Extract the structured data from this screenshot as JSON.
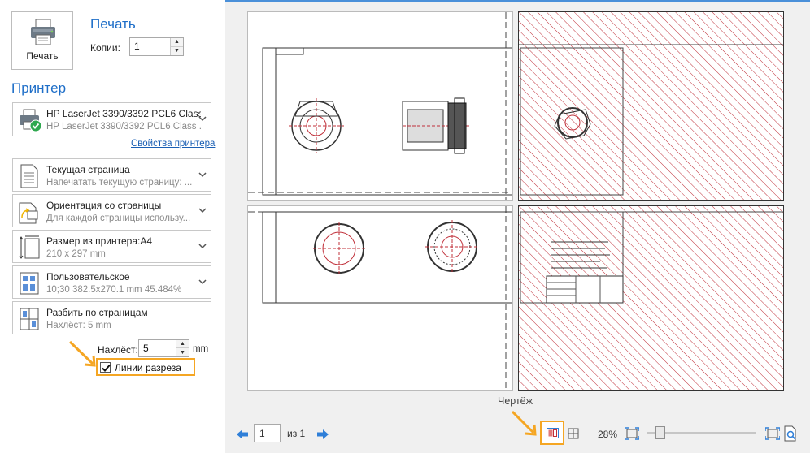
{
  "print": {
    "button_label": "Печать",
    "heading": "Печать",
    "copies_label": "Копии:",
    "copies_value": "1"
  },
  "printer": {
    "heading": "Принтер",
    "name": "HP LaserJet 3390/3392 PCL6 Class ...",
    "subtitle": "HP LaserJet 3390/3392 PCL6 Class ...",
    "properties_link": "Свойства принтера"
  },
  "settings": [
    {
      "title": "Текущая страница",
      "subtitle": "Напечатать текущую страницу: ...",
      "icon": "page-icon"
    },
    {
      "title": "Ориентация со страницы",
      "subtitle": "Для каждой страницы использу...",
      "icon": "orientation-icon"
    },
    {
      "title": "Размер из принтера:A4",
      "subtitle": "210 x 297 mm",
      "icon": "paper-size-icon"
    },
    {
      "title": "Пользовательское",
      "subtitle": "10;30   382.5x270.1 mm 45.484%",
      "icon": "scale-icon"
    },
    {
      "title": "Разбить по страницам",
      "subtitle": "Нахлёст: 5 mm",
      "icon": "split-pages-icon"
    }
  ],
  "overlap": {
    "label": "Нахлёст:",
    "value": "5",
    "unit": "mm"
  },
  "cut_lines": {
    "label": "Линии разреза",
    "checked": true
  },
  "preview": {
    "drawing_label": "Чертёж",
    "page_number": "1",
    "page_of": "из 1",
    "zoom": "28%",
    "zoom_level": 0.12
  },
  "colors": {
    "accent": "#1e6ec8",
    "highlight": "#f5a623",
    "hatch": "#c0303a"
  }
}
